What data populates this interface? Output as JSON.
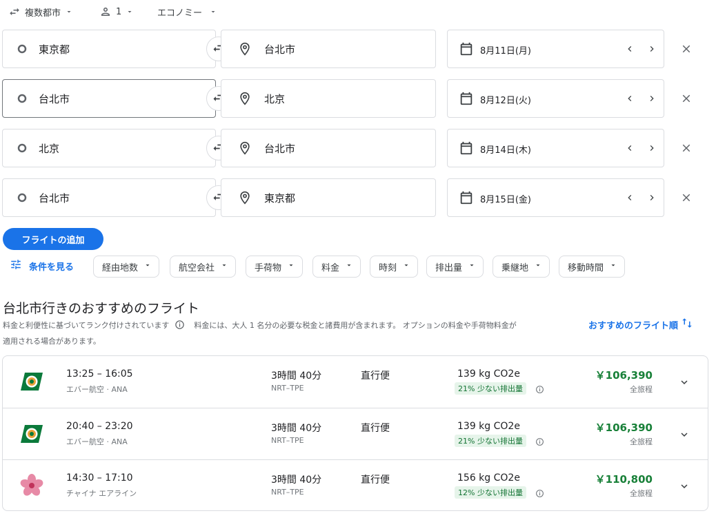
{
  "options": {
    "trip_type": "複数都市",
    "passengers": "1",
    "cabin": "エコノミー"
  },
  "segments": [
    {
      "from": "東京都",
      "to": "台北市",
      "date": "8月11日(月)"
    },
    {
      "from": "台北市",
      "to": "北京",
      "date": "8月12日(火)"
    },
    {
      "from": "北京",
      "to": "台北市",
      "date": "8月14日(木)"
    },
    {
      "from": "台北市",
      "to": "東京都",
      "date": "8月15日(金)"
    }
  ],
  "add_flight_label": "フライトの追加",
  "filters": {
    "show_conditions": "条件を見る",
    "chips": [
      "経由地数",
      "航空会社",
      "手荷物",
      "料金",
      "時刻",
      "排出量",
      "乗継地",
      "移動時間"
    ]
  },
  "results": {
    "title": "台北市行きのおすすめのフライト",
    "ranking_note": "料金と利便性に基づいてランク付けされています",
    "price_note_line1": "料金には、大人 1 名分の必要な税金と諸費用が含まれます。 オプションの料金や手荷物料金が",
    "price_note_line2": "適用される場合があります。",
    "sort_label": "おすすめのフライト順",
    "flights": [
      {
        "times": "13:25 – 16:05",
        "airline": "エバー航空 · ANA",
        "duration": "3時間 40分",
        "route": "NRT–TPE",
        "stops": "直行便",
        "co2": "139 kg CO2e",
        "emissions_badge": "21% 少ない排出量",
        "price": "￥106,390",
        "trip": "全旅程",
        "logo": "eva-air-logo"
      },
      {
        "times": "20:40 – 23:20",
        "airline": "エバー航空 · ANA",
        "duration": "3時間 40分",
        "route": "NRT–TPE",
        "stops": "直行便",
        "co2": "139 kg CO2e",
        "emissions_badge": "21% 少ない排出量",
        "price": "￥106,390",
        "trip": "全旅程",
        "logo": "eva-air-logo"
      },
      {
        "times": "14:30 – 17:10",
        "airline": "チャイナ エアライン",
        "duration": "3時間 40分",
        "route": "NRT–TPE",
        "stops": "直行便",
        "co2": "156 kg CO2e",
        "emissions_badge": "12% 少ない排出量",
        "price": "￥110,800",
        "trip": "全旅程",
        "logo": "china-airlines-logo"
      }
    ]
  },
  "colors": {
    "accent": "#1a73e8",
    "price_green": "#188038",
    "badge_bg": "#e6f4ea",
    "badge_text": "#137333"
  }
}
